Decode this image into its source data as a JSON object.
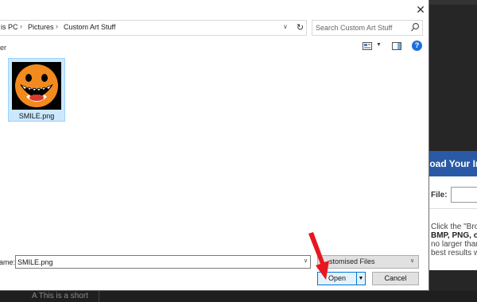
{
  "background_page": {
    "panel_title": "load Your Im",
    "file_label": "File:",
    "info_lines": [
      "Click the \"Bro",
      "BMP, PNG, or E",
      "no larger than",
      "best results w"
    ],
    "bottom_text": "A  This is a short"
  },
  "dialog": {
    "close_glyph": "✕",
    "address": {
      "crumbs": [
        "is PC",
        "Pictures",
        "Custom Art Stuff"
      ],
      "separator": "›",
      "dropdown_glyph": "∨",
      "refresh_glyph": "↻"
    },
    "search": {
      "placeholder": "Search Custom Art Stuff",
      "icon": "search-icon"
    },
    "toolbar": {
      "partial_label": "er",
      "view_dropdown_glyph": "▼",
      "help_glyph": "?"
    },
    "files": [
      {
        "name": "SMILE.png",
        "selected": true,
        "icon": "smiley-thumbnail"
      }
    ],
    "footer": {
      "filename_label": "ame:",
      "filename_value": "SMILE.png",
      "filetype_value": "stomised Files",
      "open_label": "Open",
      "cancel_label": "Cancel",
      "dropdown_glyph": "∨",
      "split_glyph": "▼"
    }
  },
  "colors": {
    "accent": "#0078d7",
    "selection": "#cce8ff",
    "arrow": "#e8171d",
    "panel_header": "#2a5aa6"
  }
}
